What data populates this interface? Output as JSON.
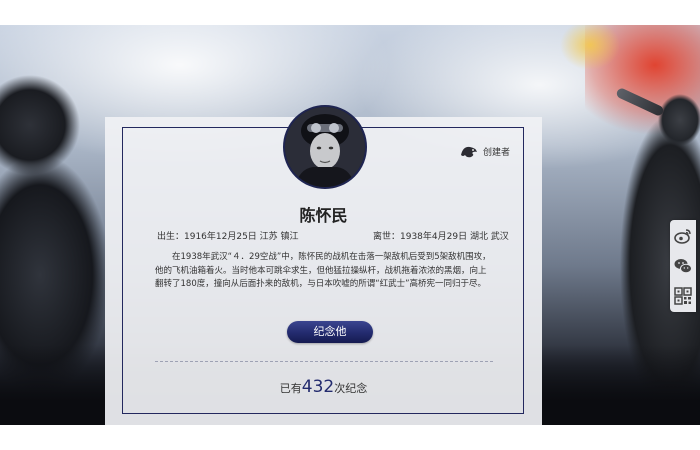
{
  "profile": {
    "name": "陈怀民",
    "birth": "出生：1916年12月25日   江苏 镇江",
    "death": "离世：1938年4月29日  湖北 武汉",
    "bio": "在1938年武汉“４．29空战”中，陈怀民的战机在击落一架敌机后受到5架敌机围攻，他的飞机油箱着火。当时他本可跳伞求生，但他猛拉操纵杆，战机拖着浓浓的黑烟，向上翻转了180度，撞向从后面扑来的敌机，与日本吹嘘的所谓“红武士”高桥宪一同归于尽。",
    "creator_label": "创建者"
  },
  "actions": {
    "memorial_button": "纪念他"
  },
  "stats": {
    "prefix": "已有",
    "count": "432",
    "suffix": "次纪念"
  },
  "share": {
    "items": [
      "weibo-icon",
      "wechat-icon",
      "qrcode-icon"
    ]
  },
  "colors": {
    "accent": "#232b6e",
    "frame": "#23285e",
    "weibo": "#555555"
  }
}
